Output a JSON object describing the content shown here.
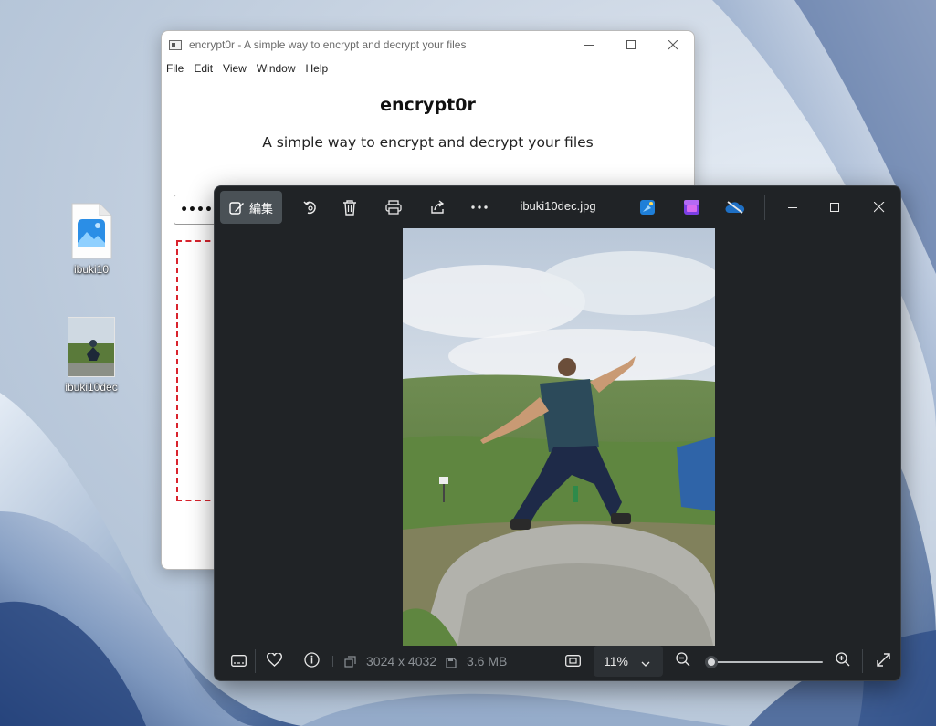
{
  "desktop": {
    "icons": [
      {
        "label": "ibuki10"
      },
      {
        "label": "ibuki10dec"
      }
    ]
  },
  "encryptor": {
    "window_title": "encrypt0r - A simple way to encrypt and decrypt your files",
    "menu": [
      "File",
      "Edit",
      "View",
      "Window",
      "Help"
    ],
    "heading": "encrypt0r",
    "subtitle": "A simple way to encrypt and decrypt your files",
    "password_mask": "••••",
    "colors": {
      "drop_border": "#d9232d"
    }
  },
  "photos": {
    "toolbar": {
      "edit_label": "編集",
      "icons": [
        "edit-icon",
        "rotate-icon",
        "delete-icon",
        "print-icon",
        "share-icon",
        "more-icon",
        "paint-icon",
        "clipchamp-icon",
        "onedrive-icon"
      ]
    },
    "file_name": "ibuki10dec.jpg",
    "status": {
      "dimensions": "3024 x 4032",
      "file_size": "3.6 MB",
      "zoom": "11%",
      "zoom_level_fraction": 0.0
    },
    "colors": {
      "background": "#202326",
      "accent": "#0078d4"
    }
  }
}
